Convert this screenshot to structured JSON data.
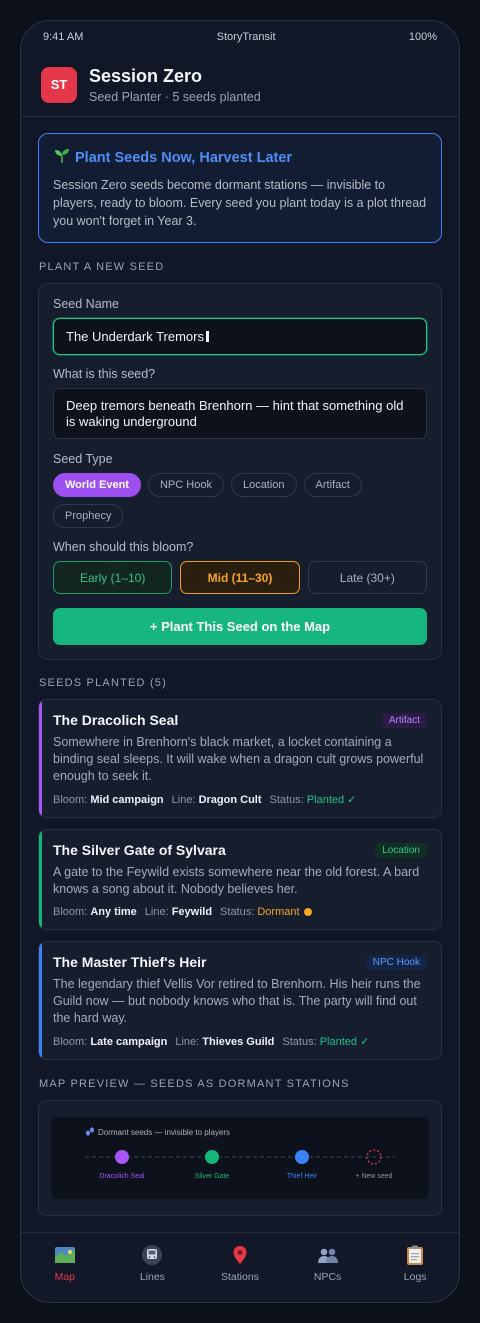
{
  "status_bar": {
    "time": "9:41 AM",
    "app": "StoryTransit",
    "battery": "100%"
  },
  "header": {
    "logo": "ST",
    "title": "Session Zero",
    "subtitle": "Seed Planter · 5 seeds planted"
  },
  "banner": {
    "icon": "seedling-icon",
    "title": "Plant Seeds Now, Harvest Later",
    "body": "Session Zero seeds become dormant stations — invisible to players, ready to bloom. Every seed you plant today is a plot thread you won't forget in Year 3."
  },
  "form": {
    "section_label": "PLANT A NEW SEED",
    "seed_name_label": "Seed Name",
    "seed_name_value": "The Underdark Tremors",
    "what_label": "What is this seed?",
    "what_value": "Deep tremors beneath Brenhorn — hint that something old is waking underground",
    "type_label": "Seed Type",
    "types": [
      "World Event",
      "NPC Hook",
      "Location",
      "Artifact",
      "Prophecy"
    ],
    "selected_type": "World Event",
    "bloom_label": "When should this bloom?",
    "bloom_options": [
      "Early (1–10)",
      "Mid (11–30)",
      "Late (30+)"
    ],
    "selected_bloom": "Mid (11–30)",
    "submit_label": "+ Plant This Seed on the Map"
  },
  "seeds": {
    "section_label": "SEEDS PLANTED (5)",
    "bloom_prefix": "Bloom:",
    "line_prefix": "Line:",
    "status_prefix": "Status:",
    "items": [
      {
        "title": "The Dracolich Seal",
        "badge": "Artifact",
        "accent": "#a855f7",
        "description": "Somewhere in Brenhorn's black market, a locket containing a binding seal sleeps. It will wake when a dragon cult grows powerful enough to seek it.",
        "bloom": "Mid campaign",
        "line": "Dragon Cult",
        "status": "Planted ✓"
      },
      {
        "title": "The Silver Gate of Sylvara",
        "badge": "Location",
        "accent": "#16b67a",
        "description": "A gate to the Feywild exists somewhere near the old forest. A bard knows a song about it. Nobody believes her.",
        "bloom": "Any time",
        "line": "Feywild",
        "status": "Dormant"
      },
      {
        "title": "The Master Thief's Heir",
        "badge": "NPC Hook",
        "accent": "#3b82f6",
        "description": "The legendary thief Vellis Vor retired to Brenhorn. His heir runs the Guild now — but nobody knows who that is. The party will find out the hard way.",
        "bloom": "Late campaign",
        "line": "Thieves Guild",
        "status": "Planted ✓"
      }
    ]
  },
  "map_preview": {
    "section_label": "MAP PREVIEW — SEEDS AS DORMANT STATIONS",
    "caption": "Dormant seeds — invisible to players",
    "stations": [
      {
        "label": "Dracolich Seal",
        "color": "#a855f7"
      },
      {
        "label": "Silver Gate",
        "color": "#16b67a"
      },
      {
        "label": "Thief Heir",
        "color": "#3b82f6"
      },
      {
        "label": "+ New seed",
        "color": "#e5374a"
      }
    ]
  },
  "tabs": [
    {
      "label": "Map",
      "icon": "map-icon",
      "active": true
    },
    {
      "label": "Lines",
      "icon": "train-icon",
      "active": false
    },
    {
      "label": "Stations",
      "icon": "pin-icon",
      "active": false
    },
    {
      "label": "NPCs",
      "icon": "people-icon",
      "active": false
    },
    {
      "label": "Logs",
      "icon": "clipboard-icon",
      "active": false
    }
  ]
}
